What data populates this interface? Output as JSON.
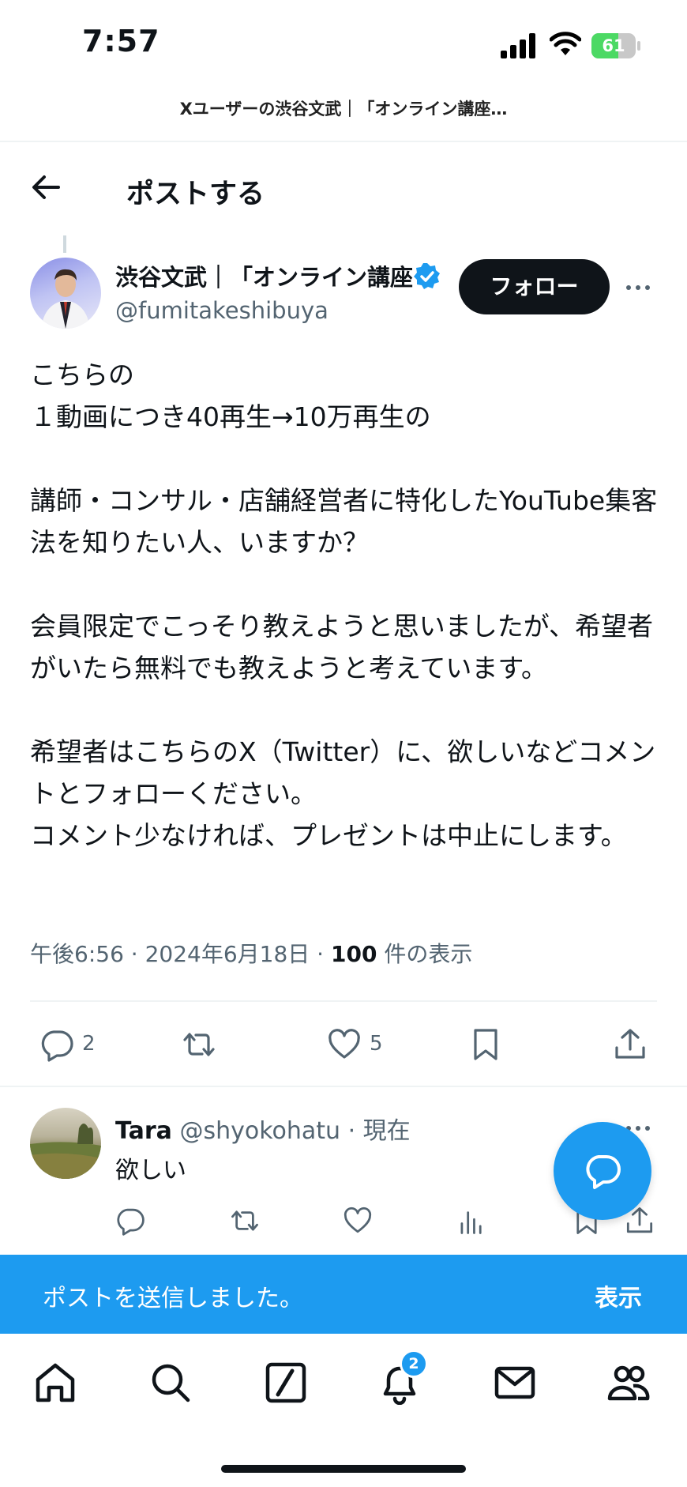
{
  "status_bar": {
    "time": "7:57",
    "battery_level": "61"
  },
  "page_title": "Xユーザーの渋谷文武｜「オンライン講座…",
  "header": {
    "title": "ポストする"
  },
  "post": {
    "author_name": "渋谷文武｜「オンライン講座",
    "author_handle": "@fumitakeshibuya",
    "follow_label": "フォロー",
    "body": "こちらの\n１動画につき40再生→10万再生の\n\n講師・コンサル・店舗経営者に特化したYouTube集客法を知りたい人、いますか？\n\n会員限定でこっそり教えようと思いましたが、希望者がいたら無料でも教えようと考えています。\n\n希望者はこちらのX（Twitter）に、欲しいなどコメントとフォローください。\nコメント少なければ、プレゼントは中止にします。",
    "meta_time": "午後6:56 · 2024年6月18日 · ",
    "meta_views": "100",
    "meta_views_suffix": " 件の表示",
    "reply_count": "2",
    "like_count": "5"
  },
  "reply": {
    "name": "Tara",
    "handle": "@shyokohatu",
    "time": " · 現在",
    "text": "欲しい"
  },
  "toast": {
    "message": "ポストを送信しました。",
    "action": "表示"
  },
  "nav": {
    "notification_badge": "2"
  },
  "colors": {
    "accent": "#1d9bf0",
    "text": "#0f1419",
    "secondary": "#536471"
  }
}
